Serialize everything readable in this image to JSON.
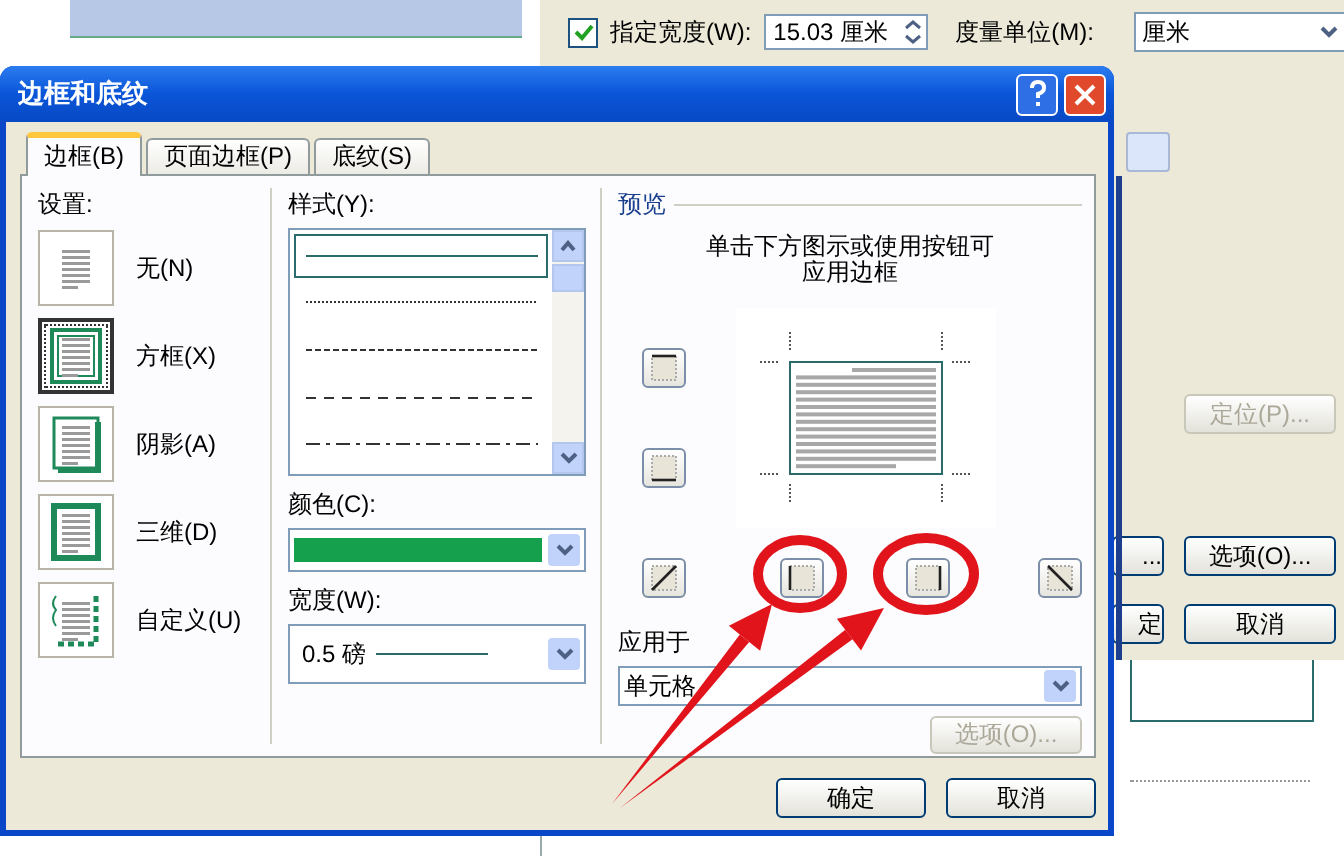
{
  "background_window": {
    "width_checkbox": {
      "label": "指定宽度(W):",
      "checked": true
    },
    "width_value": "15.03 厘米",
    "unit_label": "度量单位(M):",
    "unit_value": "厘米",
    "button_rows": [
      {
        "buttons": [
          {
            "label": "定位(P)...",
            "disabled": true
          }
        ]
      },
      {
        "buttons": [
          {
            "label": "...",
            "disabled": false
          },
          {
            "label": "选项(O)...",
            "disabled": false
          }
        ]
      },
      {
        "buttons": [
          {
            "label": "定",
            "disabled": false
          },
          {
            "label": "取消",
            "disabled": false
          }
        ]
      }
    ]
  },
  "dialog": {
    "title": "边框和底纹",
    "tabs": [
      {
        "label": "边框(B)",
        "selected": true
      },
      {
        "label": "页面边框(P)",
        "selected": false
      },
      {
        "label": "底纹(S)",
        "selected": false
      }
    ],
    "settings": {
      "label": "设置:",
      "items": [
        {
          "label": "无(N)",
          "kind": "none",
          "selected": false
        },
        {
          "label": "方框(X)",
          "kind": "box",
          "selected": true
        },
        {
          "label": "阴影(A)",
          "kind": "shadow",
          "selected": false
        },
        {
          "label": "三维(D)",
          "kind": "three-d",
          "selected": false
        },
        {
          "label": "自定义(U)",
          "kind": "custom",
          "selected": false
        }
      ]
    },
    "style": {
      "label": "样式(Y):",
      "options": [
        {
          "kind": "solid",
          "selected": true
        },
        {
          "kind": "dotted",
          "selected": false
        },
        {
          "kind": "fine-dashed",
          "selected": false
        },
        {
          "kind": "dashed",
          "selected": false
        },
        {
          "kind": "dash-dot",
          "selected": false
        }
      ]
    },
    "color": {
      "label": "颜色(C):",
      "color": "#14a04c"
    },
    "width": {
      "label": "宽度(W):",
      "value": "0.5 磅"
    },
    "preview": {
      "heading": "预览",
      "hint": "单击下方图示或使用按钮可应用边框"
    },
    "apply_to": {
      "label": "应用于",
      "value": "单元格"
    },
    "options_button": {
      "label": "选项(O)...",
      "disabled": true
    },
    "buttons": [
      "确定",
      "取消"
    ]
  },
  "annotations": [
    {
      "kind": "circle"
    },
    {
      "kind": "circle"
    },
    {
      "kind": "arrow"
    },
    {
      "kind": "arrow"
    }
  ]
}
